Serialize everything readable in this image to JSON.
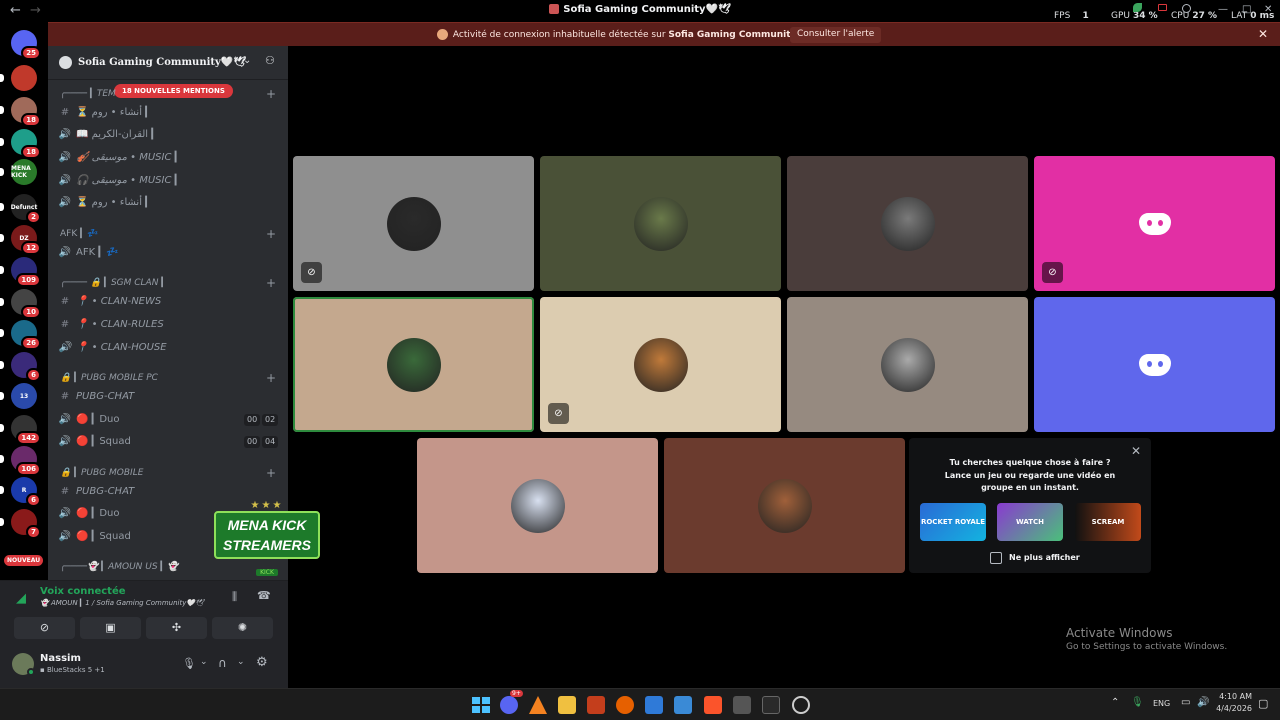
{
  "window": {
    "title": "Sofia Gaming Community🤍🕊",
    "nav_back": "←",
    "nav_forward": "→"
  },
  "stats": {
    "fps_label": "FPS",
    "fps_value": "1",
    "gpu_label": "GPU",
    "gpu_value": "34 %",
    "cpu_label": "CPU",
    "cpu_value": "27 %",
    "lat_label": "LAT",
    "lat_value": "0 ms"
  },
  "banner": {
    "text_prefix": "Activité de connexion inhabituelle détectée sur ",
    "server": "Sofia Gaming Community🤍🕊",
    "button": "Consulter l'alerte",
    "close": "✕"
  },
  "rail": {
    "servers": [
      {
        "label": "",
        "badge": "25",
        "color": "#5865f2"
      },
      {
        "label": "",
        "badge": "",
        "color": "#c0392b"
      },
      {
        "label": "",
        "badge": "18",
        "color": "#a06a5a"
      },
      {
        "label": "",
        "badge": "18",
        "color": "#1e9e8a"
      },
      {
        "label": "MENA KICK",
        "badge": "",
        "color": "#2a7a2a"
      },
      {
        "label": "Defunct",
        "badge": "2",
        "color": "#222222"
      },
      {
        "label": "DZ",
        "badge": "12",
        "color": "#7a1a1a"
      },
      {
        "label": "",
        "badge": "109",
        "color": "#2a2a7a"
      },
      {
        "label": "",
        "badge": "10",
        "color": "#444444"
      },
      {
        "label": "",
        "badge": "26",
        "color": "#1a6a8a"
      },
      {
        "label": "",
        "badge": "6",
        "color": "#3a2a7a"
      },
      {
        "label": "13",
        "badge": "",
        "color": "#2a4aaa"
      },
      {
        "label": "",
        "badge": "142",
        "color": "#333333"
      },
      {
        "label": "",
        "badge": "106",
        "color": "#6a2a6a"
      },
      {
        "label": "R",
        "badge": "6",
        "color": "#1a3aaa"
      },
      {
        "label": "",
        "badge": "7",
        "color": "#8a1a1a"
      }
    ],
    "new_label": "NOUVEAU"
  },
  "sidebar": {
    "server_name": "Sofia Gaming Community🤍🕊",
    "mentions": "18 NOUVELLES MENTIONS",
    "categories": [
      {
        "label": "╭──── ▎TEM"
      },
      {
        "label": "AFK ▎💤"
      },
      {
        "label": "╭──── 🔒 ▎SGM CLAN ▎"
      },
      {
        "label": "🔒 ▎PUBG MOBILE PC"
      },
      {
        "label": "🔒 ▎PUBG MOBILE"
      },
      {
        "label": "╭────👻 ▎AMOUN US ▎👻"
      }
    ],
    "channels": [
      {
        "icon": "#",
        "text": "⏳ أنشاء • روم ▎"
      },
      {
        "icon": "🔊",
        "text": "📖 القران-الكريم ▎"
      },
      {
        "icon": "🔊",
        "text": "🎻 موسيقى • MUSIC ▎"
      },
      {
        "icon": "🔊",
        "text": "🎧 موسيقى • MUSIC ▎"
      },
      {
        "icon": "🔊",
        "text": "⏳ أنشاء • روم ▎"
      },
      {
        "icon": "🔊",
        "text": "AFK ▎💤"
      },
      {
        "icon": "#",
        "text": "📍 • CLAN-NEWS"
      },
      {
        "icon": "#",
        "text": "📍 • CLAN-RULES"
      },
      {
        "icon": "🔊",
        "text": "📍 • CLAN-HOUSE"
      },
      {
        "icon": "#",
        "text": "PUBG-CHAT"
      },
      {
        "icon": "🔊",
        "text": "🔴 ▎Duo"
      },
      {
        "icon": "🔊",
        "text": "🔴 ▎Squad"
      },
      {
        "icon": "#",
        "text": "PUBG-CHAT"
      },
      {
        "icon": "🔊",
        "text": "🔴 ▎Duo"
      },
      {
        "icon": "🔊",
        "text": "🔴 ▎Squad"
      }
    ],
    "counts": {
      "duo1_a": "00",
      "duo1_b": "02",
      "squad1_a": "00",
      "squad1_b": "04"
    }
  },
  "overlay_logo": {
    "line1": "MENA KICK",
    "line2": "STREAMERS",
    "sub": "KICK"
  },
  "voice": {
    "status": "Voix connectée",
    "channel": "👻 AMOUN ▎1 / Sofia Gaming Community🤍🕊"
  },
  "user": {
    "name": "Nassim",
    "activity": "BlueStacks 5 +1"
  },
  "tiles": [
    {
      "bg": "#8f8f8f",
      "muted": true
    },
    {
      "bg": "#4a5137",
      "muted": false
    },
    {
      "bg": "#4a3d3b",
      "muted": false
    },
    {
      "bg": "#e22fa4",
      "muted": true,
      "discord": true
    },
    {
      "bg": "#c4a88e",
      "muted": false,
      "speaking": true
    },
    {
      "bg": "#dcccb0",
      "muted": true
    },
    {
      "bg": "#968a80",
      "muted": false
    },
    {
      "bg": "#5f67ec",
      "muted": false,
      "discord": true
    },
    {
      "bg": "#c4968a",
      "muted": false
    },
    {
      "bg": "#6b3b2e",
      "muted": false
    }
  ],
  "activity_card": {
    "title": "Tu cherches quelque chose à faire ?",
    "body": "Lance un jeu ou regarde une vidéo en groupe en un instant.",
    "games": [
      "ROCKET ROYALE",
      "WATCH TOGETHER",
      "SCREAM"
    ],
    "checkbox": "Ne plus afficher"
  },
  "watermark": {
    "title": "Activate Windows",
    "sub": "Go to Settings to activate Windows."
  },
  "taskbar": {
    "lang": "ENG",
    "time": "4:10 AM",
    "date": "4/4/2026",
    "discord_badge": "9+"
  }
}
